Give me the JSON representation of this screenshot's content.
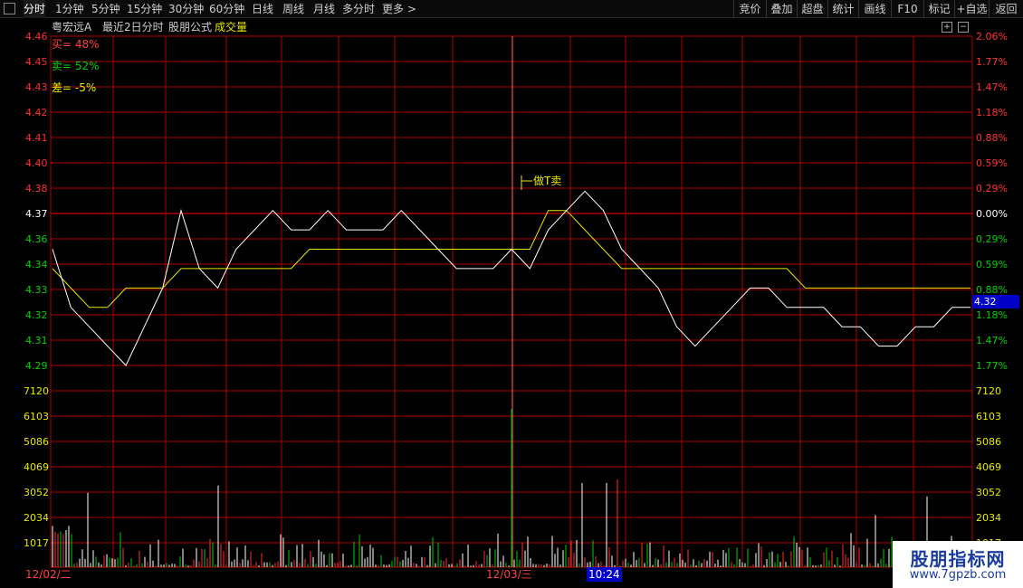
{
  "toolbar": {
    "periods": [
      "分时",
      "1分钟",
      "5分钟",
      "15分钟",
      "30分钟",
      "60分钟",
      "日线",
      "周线",
      "月线",
      "多分时",
      "更多"
    ],
    "right_buttons": [
      "竞价",
      "叠加",
      "超盘",
      "统计",
      "画线",
      "F10",
      "标记",
      "+自选",
      "返回"
    ]
  },
  "info": {
    "stock_name": "粤宏远A",
    "mode": "最近2日分时",
    "formula": "股朋公式",
    "volume_label": "成交量"
  },
  "indicators": {
    "buy": "买= 48%",
    "sell": "卖= 52%",
    "diff": "差= -5%"
  },
  "annotation": "做T卖",
  "price_panel": {
    "left_labels": [
      "4.46",
      "4.45",
      "4.43",
      "4.42",
      "4.41",
      "4.40",
      "4.38",
      "4.37",
      "4.36",
      "4.34",
      "4.33",
      "4.32",
      "4.31",
      "4.29"
    ],
    "right_labels": [
      "2.06%",
      "1.77%",
      "1.47%",
      "1.18%",
      "0.88%",
      "0.59%",
      "0.29%",
      "0.00%",
      "0.29%",
      "0.59%",
      "0.88%",
      "1.18%",
      "1.47%",
      "1.77%"
    ],
    "current_price": "4.32"
  },
  "volume_panel": {
    "labels": [
      "7120",
      "6103",
      "5086",
      "4069",
      "3052",
      "2034",
      "1017"
    ]
  },
  "time_axis": {
    "day1": "12/02/二",
    "day2": "12/03/三",
    "cursor": "10:24"
  },
  "watermark": {
    "main": "股朋指标网",
    "url": "www.7gpzb.com"
  },
  "colors": {
    "grid": "#b00000",
    "price_line": "#ffffff",
    "avg_line": "#e8e800",
    "up": "#ff3030",
    "down": "#00d000",
    "neutral_axis": "#ffffff"
  },
  "chart_data": {
    "type": "line",
    "ylim": [
      4.29,
      4.46
    ],
    "base_price": 4.37,
    "series": [
      {
        "name": "price",
        "values": [
          4.35,
          4.32,
          4.31,
          4.3,
          4.29,
          4.31,
          4.33,
          4.37,
          4.34,
          4.33,
          4.35,
          4.36,
          4.37,
          4.36,
          4.36,
          4.37,
          4.36,
          4.36,
          4.36,
          4.37,
          4.36,
          4.35,
          4.34,
          4.34,
          4.34,
          4.35,
          4.34,
          4.36,
          4.37,
          4.38,
          4.37,
          4.35,
          4.34,
          4.33,
          4.31,
          4.3,
          4.31,
          4.32,
          4.33,
          4.33,
          4.32,
          4.32,
          4.32,
          4.31,
          4.31,
          4.3,
          4.3,
          4.31,
          4.31,
          4.32,
          4.32
        ]
      },
      {
        "name": "average",
        "values": [
          4.34,
          4.33,
          4.32,
          4.32,
          4.33,
          4.33,
          4.33,
          4.34,
          4.34,
          4.34,
          4.34,
          4.34,
          4.34,
          4.34,
          4.35,
          4.35,
          4.35,
          4.35,
          4.35,
          4.35,
          4.35,
          4.35,
          4.35,
          4.35,
          4.35,
          4.35,
          4.35,
          4.37,
          4.37,
          4.36,
          4.35,
          4.34,
          4.34,
          4.34,
          4.34,
          4.34,
          4.34,
          4.34,
          4.34,
          4.34,
          4.34,
          4.33,
          4.33,
          4.33,
          4.33,
          4.33,
          4.33,
          4.33,
          4.33,
          4.33,
          4.33
        ]
      }
    ],
    "volume_ylim": [
      0,
      7120
    ]
  }
}
